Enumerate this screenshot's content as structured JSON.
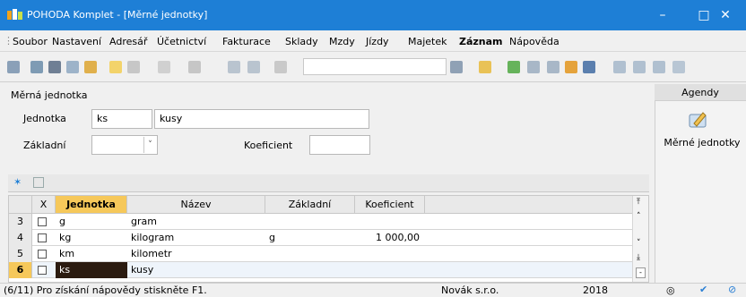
{
  "window": {
    "title": "POHODA Komplet - [Měrné jednotky]",
    "minimize": "–",
    "maximize": "□",
    "close": "✕"
  },
  "menu": [
    {
      "label": "Soubor",
      "u": 0
    },
    {
      "label": "Nastavení",
      "u": 0
    },
    {
      "label": "Adresář",
      "u": 0
    },
    {
      "label": "Účetnictví",
      "u": 0
    },
    {
      "label": "Fakturace",
      "u": 0
    },
    {
      "label": "Sklady",
      "u": 0
    },
    {
      "label": "Mzdy",
      "u": 0
    },
    {
      "label": "Jízdy",
      "u": 0
    },
    {
      "label": "Majetek",
      "u": 0
    },
    {
      "label": "Záznam",
      "u": 0
    },
    {
      "label": "Nápověda",
      "u": 0
    }
  ],
  "form": {
    "title": "Měrná jednotka",
    "jednotka_label": "Jednotka",
    "jednotka_value": "ks",
    "nazev_value": "kusy",
    "zakladni_label": "Základní",
    "zakladni_value": "",
    "koeficient_label": "Koeficient",
    "koeficient_value": ""
  },
  "gridbar": {
    "star": "✶"
  },
  "table": {
    "headers": {
      "x": "X",
      "jednotka": "Jednotka",
      "nazev": "Název",
      "zakladni": "Základní",
      "koeficient": "Koeficient"
    },
    "rows": [
      {
        "num": "3",
        "jednotka": "g",
        "nazev": "gram",
        "zakladni": "",
        "koeficient": ""
      },
      {
        "num": "4",
        "jednotka": "kg",
        "nazev": "kilogram",
        "zakladni": "g",
        "koeficient": "1 000,00"
      },
      {
        "num": "5",
        "jednotka": "km",
        "nazev": "kilometr",
        "zakladni": "",
        "koeficient": ""
      },
      {
        "num": "6",
        "jednotka": "ks",
        "nazev": "kusy",
        "zakladni": "",
        "koeficient": ""
      }
    ]
  },
  "agendy": {
    "title": "Agendy",
    "item": "Měrné jednotky"
  },
  "status": {
    "hint": "(6/11) Pro získání nápovědy stiskněte F1.",
    "company": "Novák s.r.o.",
    "year": "2018"
  },
  "colors": {
    "titlebar": "#1e7fd6",
    "active_row": "#2b1b10",
    "active_header": "#f6c85a"
  }
}
